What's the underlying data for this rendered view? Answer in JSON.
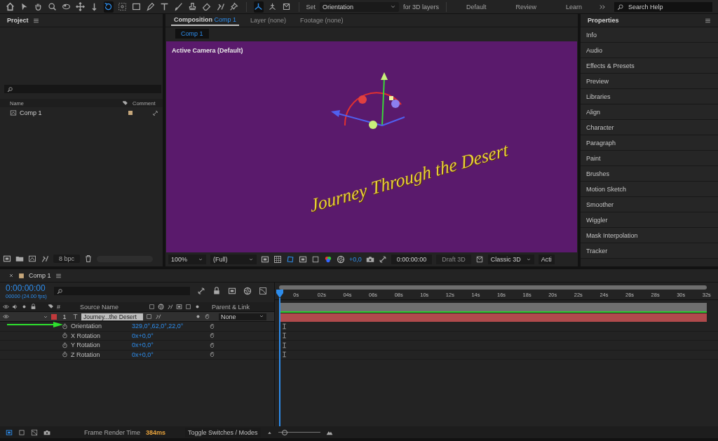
{
  "toolbar": {
    "tools": [
      {
        "kind": "home",
        "selected": false
      },
      {
        "kind": "select",
        "selected": false
      },
      {
        "kind": "hand",
        "selected": false
      },
      {
        "kind": "zoom",
        "selected": false
      },
      {
        "kind": "orbit",
        "selected": false
      },
      {
        "kind": "pan",
        "selected": false
      },
      {
        "kind": "dolly",
        "selected": false
      },
      {
        "kind": "rotate",
        "selected": true
      },
      {
        "kind": "anchor",
        "selected": false
      },
      {
        "kind": "rect",
        "selected": false
      },
      {
        "kind": "pen",
        "selected": false
      },
      {
        "kind": "type",
        "selected": false
      },
      {
        "kind": "brush",
        "selected": false
      },
      {
        "kind": "stamp",
        "selected": false
      },
      {
        "kind": "eraser",
        "selected": false
      },
      {
        "kind": "roto",
        "selected": false
      },
      {
        "kind": "pin",
        "selected": false
      }
    ],
    "axis_modes": [
      {
        "kind": "local",
        "selected": true
      },
      {
        "kind": "world",
        "selected": false
      },
      {
        "kind": "view",
        "selected": false
      }
    ],
    "set_label": "Set",
    "set_value": "Orientation",
    "set_suffix": "for 3D layers",
    "workspaces": [
      {
        "label": "Default",
        "selected": false
      },
      {
        "label": "Review",
        "selected": false
      },
      {
        "label": "Learn",
        "selected": false
      }
    ],
    "search_placeholder": "Search Help"
  },
  "project": {
    "title": "Project",
    "columns": [
      "Name",
      "Comment"
    ],
    "items": [
      {
        "name": "Comp 1",
        "selected": false
      }
    ],
    "bit_depth": "8 bpc"
  },
  "composition": {
    "tabs": [
      {
        "label": "Composition",
        "name": "Comp 1",
        "selected": true
      },
      {
        "label": "Layer (none)",
        "selected": false
      },
      {
        "label": "Footage (none)",
        "selected": false
      }
    ],
    "subtab": "Comp 1",
    "camera_label": "Active Camera (Default)",
    "text_layer": "Journey Through the Desert",
    "bar": {
      "zoom": "100%",
      "resolution": "(Full)",
      "exposure": "+0,0",
      "timecode": "0:00:00:00",
      "draft": {
        "label": "Draft 3D",
        "disabled": true
      },
      "renderer": "Classic 3D",
      "view": "Acti"
    }
  },
  "properties": {
    "title": "Properties",
    "items": [
      {
        "label": "Info",
        "selected": false
      },
      {
        "label": "Audio",
        "selected": false
      },
      {
        "label": "Effects & Presets",
        "selected": false
      },
      {
        "label": "Preview",
        "selected": false
      },
      {
        "label": "Libraries",
        "selected": false
      },
      {
        "label": "Align",
        "selected": false
      },
      {
        "label": "Character",
        "selected": false
      },
      {
        "label": "Paragraph",
        "selected": false
      },
      {
        "label": "Paint",
        "selected": false
      },
      {
        "label": "Brushes",
        "selected": false
      },
      {
        "label": "Motion Sketch",
        "selected": false
      },
      {
        "label": "Smoother",
        "selected": false
      },
      {
        "label": "Wiggler",
        "selected": false
      },
      {
        "label": "Mask Interpolation",
        "selected": false
      },
      {
        "label": "Tracker",
        "selected": false
      }
    ]
  },
  "timeline": {
    "tab": "Comp 1",
    "timecode": "0:00:00:00",
    "frames": "00000 (24.00 fps)",
    "columns": {
      "number": "#",
      "source": "Source Name",
      "parent": "Parent & Link"
    },
    "layers": [
      {
        "number": "1",
        "name": "Journey...the Desert",
        "color": "#c0393b",
        "parent": "None",
        "properties": [
          {
            "name": "Orientation",
            "value": "329,0°,62,0°,22,0°"
          },
          {
            "name": "X Rotation",
            "value": "0x+0,0°"
          },
          {
            "name": "Y Rotation",
            "value": "0x+0,0°"
          },
          {
            "name": "Z Rotation",
            "value": "0x+0,0°"
          }
        ]
      }
    ],
    "zoom_slider": {
      "level": 0.15
    },
    "ruler": [
      "0s",
      "02s",
      "04s",
      "06s",
      "08s",
      "10s",
      "12s",
      "14s",
      "16s",
      "18s",
      "20s",
      "22s",
      "24s",
      "26s",
      "28s",
      "30s",
      "32s"
    ]
  },
  "status_bar": {
    "render_label": "Frame Render Time",
    "render_value": "384ms",
    "toggle": "Toggle Switches / Modes"
  }
}
